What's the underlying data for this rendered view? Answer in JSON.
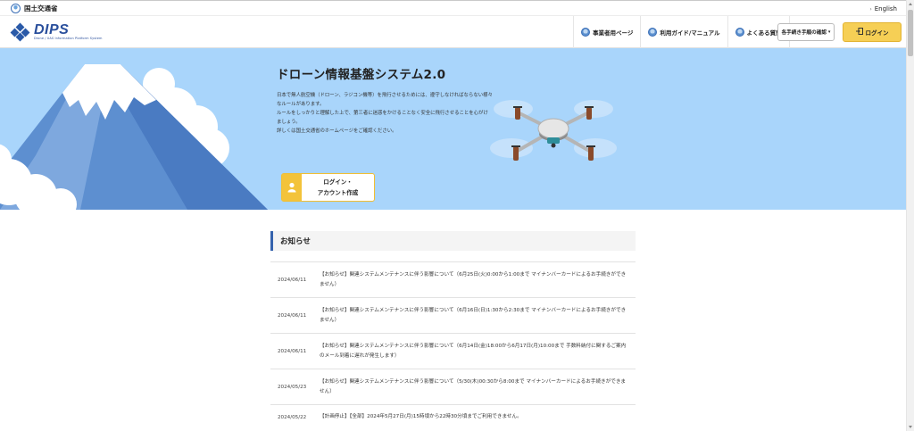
{
  "topbar": {
    "ministry_name": "国土交通省",
    "english_link": "English",
    "english_icon": "chevron-right-icon"
  },
  "header": {
    "logo_text": "DIPS",
    "logo_subtext": "Drone / UAS Information Platform System",
    "nav": [
      {
        "label": "事業者用ページ",
        "icon": "globe-icon"
      },
      {
        "label": "利用ガイド/マニュアル",
        "icon": "globe-icon"
      },
      {
        "label": "よくある質問",
        "icon": "globe-icon"
      }
    ],
    "procedure_dropdown": "各手続き手順の確認",
    "login_button": "ログイン",
    "login_icon": "login-door-icon"
  },
  "hero": {
    "title": "ドローン情報基盤システム2.0",
    "description": [
      "日本で無人航空機（ドローン、ラジコン機等）を飛行させるためには、遵守しなければならない様々なルールがあります。",
      "ルールをしっかりと理解した上で、第三者に迷惑をかけることなく安全に飛行させることを心がけましょう。",
      "詳しくは国土交通省のホームページをご確認ください。"
    ],
    "login_account_line1": "ログイン・",
    "login_account_line2": "アカウント作成",
    "login_account_icon": "user-icon"
  },
  "news": {
    "heading": "お知らせ",
    "items": [
      {
        "date": "2024/06/11",
        "text": "【お知らせ】関連システムメンテナンスに伴う影響について（6月25日(火)0:00から1:00まで マイナンバーカードによるお手続きができません）"
      },
      {
        "date": "2024/06/11",
        "text": "【お知らせ】関連システムメンテナンスに伴う影響について（6月16日(日)1:30から2:30まで マイナンバーカードによるお手続きができません）"
      },
      {
        "date": "2024/06/11",
        "text": "【お知らせ】関連システムメンテナンスに伴う影響について（6月14日(金)18:00から6月17日(月)10:00まで 手数料納付に関するご案内のメール到着に遅れが発生します）"
      },
      {
        "date": "2024/05/23",
        "text": "【お知らせ】関連システムメンテナンスに伴う影響について（5/30(木)00:30から8:00まで マイナンバーカードによるお手続きができません）"
      },
      {
        "date": "2024/05/22",
        "text": "【計画停止】【全部】2024年5月27日(月)15時頃から22時30分頃までご利用できません。"
      }
    ]
  },
  "colors": {
    "hero_bg": "#a9d5fb",
    "accent_blue": "#3462ad",
    "login_yellow": "#f6cf55"
  }
}
